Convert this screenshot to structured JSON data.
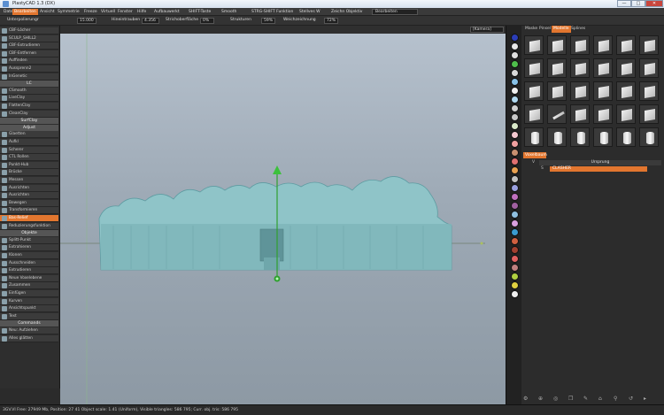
{
  "titlebar": {
    "title": "PlastyCAD 1.3 (DX)",
    "min": "—",
    "max": "□",
    "close": "✕"
  },
  "menu": [
    "Datei",
    "Bearbeiten",
    "Ansicht",
    "Symmetrie",
    "Freeze",
    "Virtuell",
    "Fenster",
    "Hilfe",
    "Aufbauwerkt",
    "SHIFT-Taste",
    "Smooth",
    "STRG-SHIFT Funktion",
    "Stellves W",
    "Zeichn Objektiv"
  ],
  "menu_box_value": "Bearbeiten",
  "toolbar": {
    "unterpolierungr_label": "Unterpolierungr",
    "unterpolierungr_value": "15.000",
    "hineintrauben_label": "Hineintrauben",
    "hineintrauben_value": "4.356",
    "strichoberfl_label": "Strichoberfläche",
    "strichoberfl_value": "0%",
    "struktur_label": "Strukturen",
    "struktur_value": "59%",
    "weichzeichnung_label": "Weichzeichnung",
    "weichzeichnung_value": "72%"
  },
  "left_tools_top": [
    "CBF-Löcher",
    "SCULP_SHILL2",
    "CBF-Extrudieren",
    "CBF-Entfernen",
    "Auffinden",
    "Aussprenn2",
    "InGenetic"
  ],
  "section_lc": "LC",
  "left_tools_mid": [
    "CSmooth",
    "LiveClay",
    "FlattenClay",
    "CleanClay"
  ],
  "section_surface": "SurfClay",
  "section_adjust": "Adjust",
  "left_tools_adjust": [
    "Glaetten",
    "Aufkl",
    "Scherer",
    "CTL Rollen",
    "Punkt-Hub",
    "Brücke",
    "Messen",
    "Ausrichten",
    "Ausrichten",
    "Bewegen",
    "Transformieren",
    "Bas-Relief",
    "Reduzierungsfunktion"
  ],
  "active_tool_index": 11,
  "section_objects": "Objekte",
  "left_tools_objects": [
    "Splitt-Punkt",
    "Extrahieren",
    "Klonen",
    "Ausschneiden",
    "Extrudieren",
    "Neue Voxelebene",
    "Zusammen",
    "Einfügen",
    "Kurven",
    "Ansichtspunkt",
    "Text"
  ],
  "section_commands": "Commands",
  "left_tools_commands": [
    "Neu: Aufziehen",
    "Alles glätten"
  ],
  "viewport": {
    "camera_label": "[Kamera]"
  },
  "right_tabs": [
    "Maske",
    "Pinsel",
    "Modelle",
    "Splines"
  ],
  "right_active_tab": 2,
  "model_rows": 5,
  "layers": {
    "tab_label": "Voxelbaum",
    "root_name": "Ursprung",
    "child_name": "CLASHER",
    "root_flag": "V",
    "child_flag": "S"
  },
  "swatch_colors": [
    "#2b3db7",
    "#e7e7e7",
    "#e0e0e0",
    "#4fbe4b",
    "#d9d9d9",
    "#88c2e8",
    "#f0f0f0",
    "#b0d8f0",
    "#cfcfcf",
    "#c8c8c8",
    "#d8e8c8",
    "#f4c8d0",
    "#f0a0a0",
    "#c89070",
    "#e07070",
    "#e8a050",
    "#c0c0c0",
    "#9aa0e0",
    "#c070c0",
    "#a060a0",
    "#90c0e0",
    "#d8a0e0",
    "#3a9bd0",
    "#d06040",
    "#a04030",
    "#e06060",
    "#c08080",
    "#b0d040",
    "#e0d040",
    "#f0f0f0"
  ],
  "status": "3GV.VI    Free: 27949 Mb, Position: 27 41 Object scale: 1.41 (Uniform), Visible triangles: 586 795; Curr. obj. tris: 586 795",
  "bottom_icons": [
    "⚙",
    "⊕",
    "◎",
    "❐",
    "✎",
    "⌂",
    "⚲",
    "↺",
    "▸"
  ]
}
